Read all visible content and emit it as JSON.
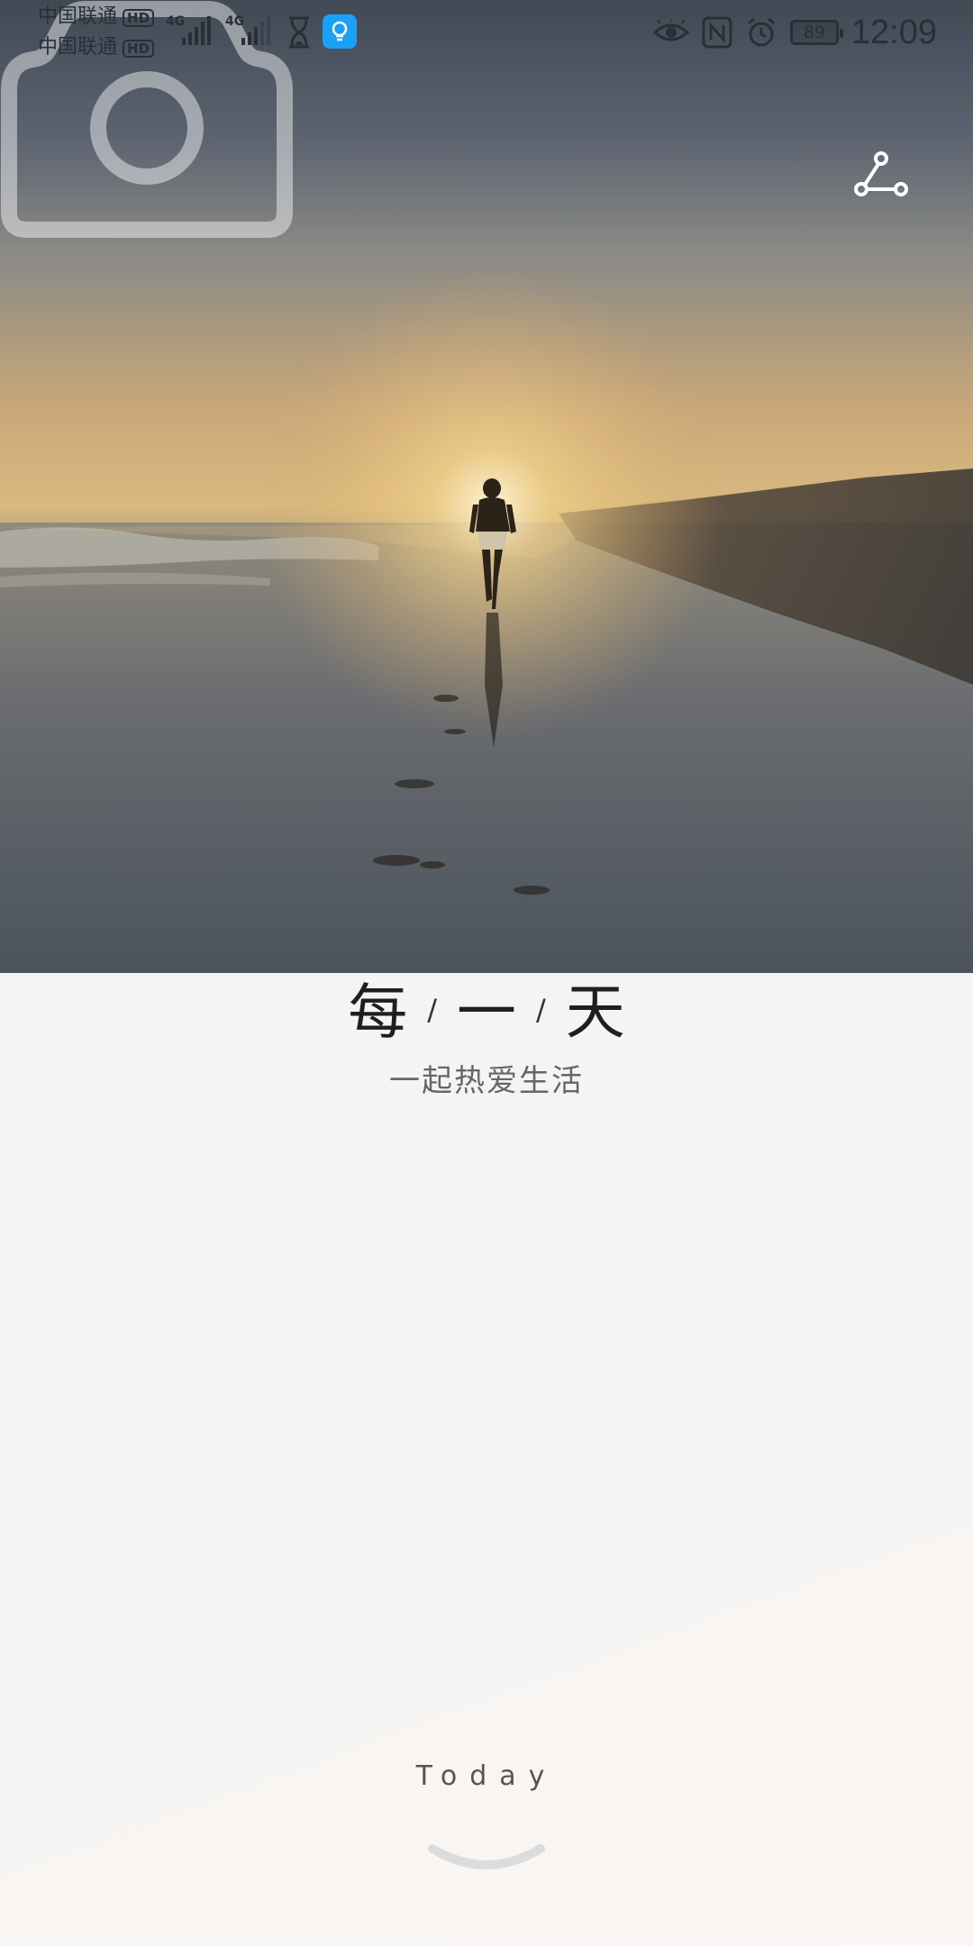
{
  "status_bar": {
    "carrier_1": "中国联通",
    "carrier_2": "中国联通",
    "hd": "HD",
    "net_1": "4G",
    "net_2": "4G",
    "battery": "89",
    "time": "12:09"
  },
  "hero": {
    "share_icon": "share-icon",
    "camera_icon": "camera-icon",
    "image": "sunset-beach-runner"
  },
  "main": {
    "title_chars": [
      "每",
      "一",
      "天"
    ],
    "separator": "/",
    "subtitle": "一起热爱生活"
  },
  "footer": {
    "today_label": "Today",
    "smile_icon": "smile-arc-icon"
  },
  "colors": {
    "accent": "#1aa0f5",
    "title": "#1d1f22",
    "subtitle": "#666666"
  }
}
